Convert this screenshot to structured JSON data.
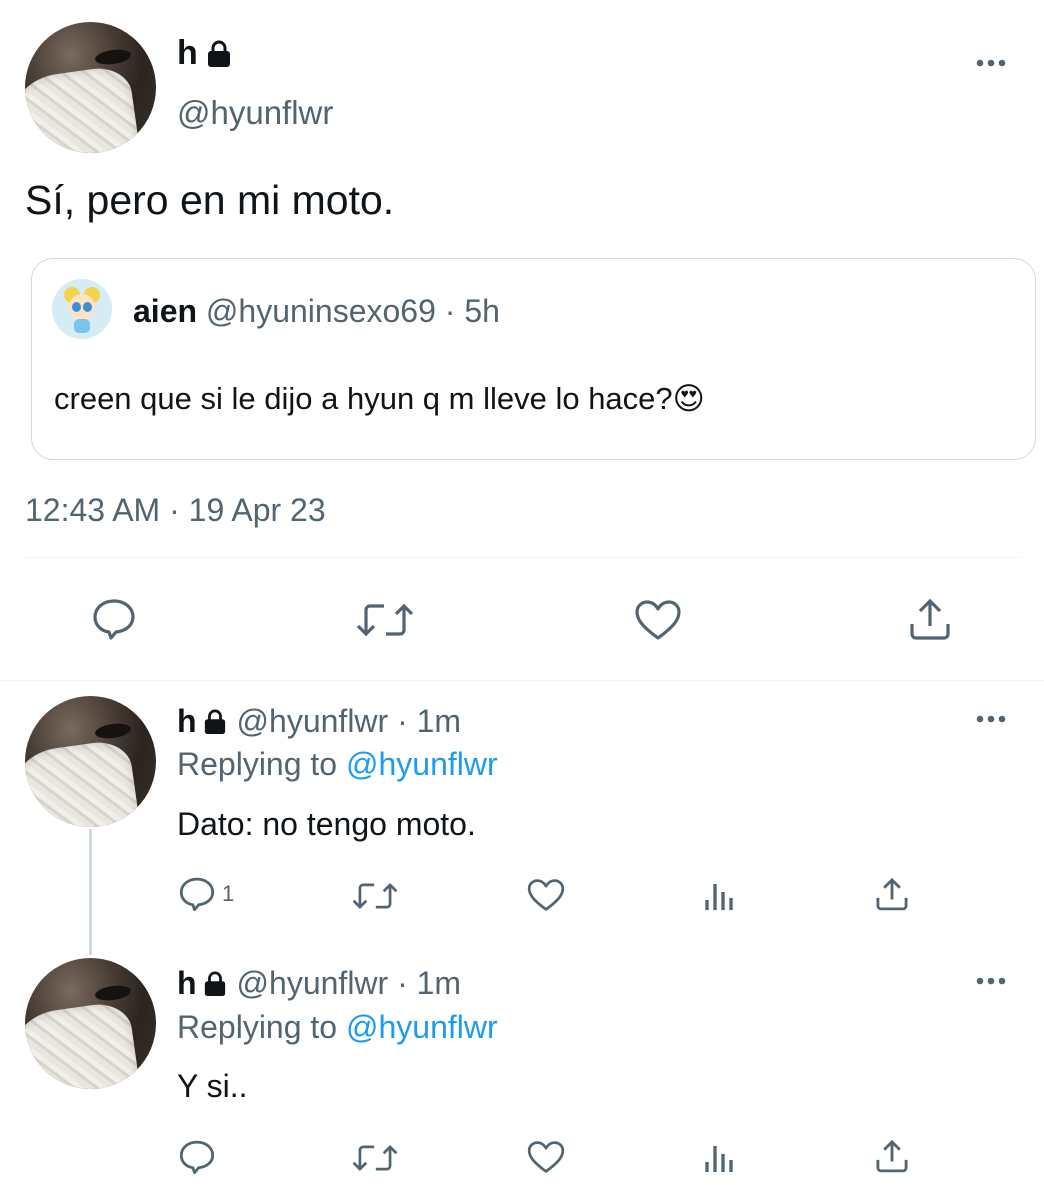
{
  "main_tweet": {
    "display_name": "h",
    "handle": "@hyunflwr",
    "text": "Sí, pero en mi moto.",
    "timestamp": "12:43 AM · 19 Apr 23",
    "quoted": {
      "display_name": "aien",
      "handle": "@hyuninsexo69",
      "separator": " · ",
      "time": "5h",
      "text": "creen que si le dijo a hyun q m lleve lo hace?",
      "emoji": "😍"
    }
  },
  "replies": [
    {
      "display_name": "h",
      "handle": "@hyunflwr",
      "time": " · 1m",
      "replying_label": "Replying to ",
      "replying_handle": "@hyunflwr",
      "text": "Dato: no tengo moto.",
      "reply_count": "1"
    },
    {
      "display_name": "h",
      "handle": "@hyunflwr",
      "time": " · 1m",
      "replying_label": "Replying to ",
      "replying_handle": "@hyunflwr",
      "text": "Y si..",
      "reply_count": ""
    }
  ],
  "colors": {
    "secondary_text": "#536471",
    "link": "#1d9bf0",
    "divider": "#eff3f4"
  }
}
